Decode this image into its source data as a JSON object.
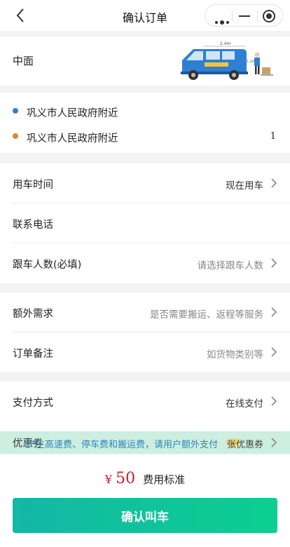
{
  "nav": {
    "title": "确认订单"
  },
  "vehicle": {
    "name": "中面",
    "width_label": "2.4m",
    "height_label": "1.2m"
  },
  "addresses": [
    {
      "text": "巩义市人民政府附近",
      "dot_color": "#3a7bd5"
    },
    {
      "text": "巩义市人民政府附近",
      "dot_color": "#e9822f",
      "count": "1"
    }
  ],
  "rows": {
    "time": {
      "label": "用车时间",
      "value": "现在用车"
    },
    "phone": {
      "label": "联系电话"
    },
    "people": {
      "label": "跟车人数(必填)",
      "placeholder": "请选择跟车人数"
    },
    "extra": {
      "label": "额外需求",
      "placeholder": "是否需要搬运、返程等服务"
    },
    "remark": {
      "label": "订单备注",
      "placeholder": "如货物类别等"
    },
    "payment": {
      "label": "支付方式",
      "value": "在线支付"
    }
  },
  "banner": {
    "coupon_label": "优惠券",
    "text": "产生高速费、停车费和搬运费，请用户额外支付",
    "value": "张优惠券"
  },
  "footer": {
    "currency": "¥",
    "price": "50",
    "price_label": "费用标准",
    "confirm_label": "确认叫车"
  },
  "colors": {
    "accent_start": "#13b7a6",
    "accent_end": "#0ccf90",
    "price": "#c0262d",
    "banner_bg": "#cdeee1"
  }
}
